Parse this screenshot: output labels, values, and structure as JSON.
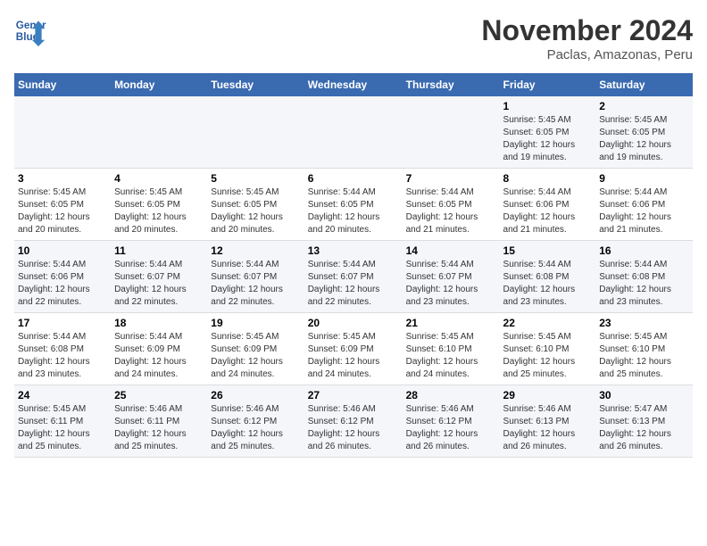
{
  "header": {
    "logo_line1": "General",
    "logo_line2": "Blue",
    "title": "November 2024",
    "subtitle": "Paclas, Amazonas, Peru"
  },
  "weekdays": [
    "Sunday",
    "Monday",
    "Tuesday",
    "Wednesday",
    "Thursday",
    "Friday",
    "Saturday"
  ],
  "weeks": [
    {
      "days": [
        {
          "num": "",
          "info": ""
        },
        {
          "num": "",
          "info": ""
        },
        {
          "num": "",
          "info": ""
        },
        {
          "num": "",
          "info": ""
        },
        {
          "num": "",
          "info": ""
        },
        {
          "num": "1",
          "info": "Sunrise: 5:45 AM\nSunset: 6:05 PM\nDaylight: 12 hours\nand 19 minutes."
        },
        {
          "num": "2",
          "info": "Sunrise: 5:45 AM\nSunset: 6:05 PM\nDaylight: 12 hours\nand 19 minutes."
        }
      ]
    },
    {
      "days": [
        {
          "num": "3",
          "info": "Sunrise: 5:45 AM\nSunset: 6:05 PM\nDaylight: 12 hours\nand 20 minutes."
        },
        {
          "num": "4",
          "info": "Sunrise: 5:45 AM\nSunset: 6:05 PM\nDaylight: 12 hours\nand 20 minutes."
        },
        {
          "num": "5",
          "info": "Sunrise: 5:45 AM\nSunset: 6:05 PM\nDaylight: 12 hours\nand 20 minutes."
        },
        {
          "num": "6",
          "info": "Sunrise: 5:44 AM\nSunset: 6:05 PM\nDaylight: 12 hours\nand 20 minutes."
        },
        {
          "num": "7",
          "info": "Sunrise: 5:44 AM\nSunset: 6:05 PM\nDaylight: 12 hours\nand 21 minutes."
        },
        {
          "num": "8",
          "info": "Sunrise: 5:44 AM\nSunset: 6:06 PM\nDaylight: 12 hours\nand 21 minutes."
        },
        {
          "num": "9",
          "info": "Sunrise: 5:44 AM\nSunset: 6:06 PM\nDaylight: 12 hours\nand 21 minutes."
        }
      ]
    },
    {
      "days": [
        {
          "num": "10",
          "info": "Sunrise: 5:44 AM\nSunset: 6:06 PM\nDaylight: 12 hours\nand 22 minutes."
        },
        {
          "num": "11",
          "info": "Sunrise: 5:44 AM\nSunset: 6:07 PM\nDaylight: 12 hours\nand 22 minutes."
        },
        {
          "num": "12",
          "info": "Sunrise: 5:44 AM\nSunset: 6:07 PM\nDaylight: 12 hours\nand 22 minutes."
        },
        {
          "num": "13",
          "info": "Sunrise: 5:44 AM\nSunset: 6:07 PM\nDaylight: 12 hours\nand 22 minutes."
        },
        {
          "num": "14",
          "info": "Sunrise: 5:44 AM\nSunset: 6:07 PM\nDaylight: 12 hours\nand 23 minutes."
        },
        {
          "num": "15",
          "info": "Sunrise: 5:44 AM\nSunset: 6:08 PM\nDaylight: 12 hours\nand 23 minutes."
        },
        {
          "num": "16",
          "info": "Sunrise: 5:44 AM\nSunset: 6:08 PM\nDaylight: 12 hours\nand 23 minutes."
        }
      ]
    },
    {
      "days": [
        {
          "num": "17",
          "info": "Sunrise: 5:44 AM\nSunset: 6:08 PM\nDaylight: 12 hours\nand 23 minutes."
        },
        {
          "num": "18",
          "info": "Sunrise: 5:44 AM\nSunset: 6:09 PM\nDaylight: 12 hours\nand 24 minutes."
        },
        {
          "num": "19",
          "info": "Sunrise: 5:45 AM\nSunset: 6:09 PM\nDaylight: 12 hours\nand 24 minutes."
        },
        {
          "num": "20",
          "info": "Sunrise: 5:45 AM\nSunset: 6:09 PM\nDaylight: 12 hours\nand 24 minutes."
        },
        {
          "num": "21",
          "info": "Sunrise: 5:45 AM\nSunset: 6:10 PM\nDaylight: 12 hours\nand 24 minutes."
        },
        {
          "num": "22",
          "info": "Sunrise: 5:45 AM\nSunset: 6:10 PM\nDaylight: 12 hours\nand 25 minutes."
        },
        {
          "num": "23",
          "info": "Sunrise: 5:45 AM\nSunset: 6:10 PM\nDaylight: 12 hours\nand 25 minutes."
        }
      ]
    },
    {
      "days": [
        {
          "num": "24",
          "info": "Sunrise: 5:45 AM\nSunset: 6:11 PM\nDaylight: 12 hours\nand 25 minutes."
        },
        {
          "num": "25",
          "info": "Sunrise: 5:46 AM\nSunset: 6:11 PM\nDaylight: 12 hours\nand 25 minutes."
        },
        {
          "num": "26",
          "info": "Sunrise: 5:46 AM\nSunset: 6:12 PM\nDaylight: 12 hours\nand 25 minutes."
        },
        {
          "num": "27",
          "info": "Sunrise: 5:46 AM\nSunset: 6:12 PM\nDaylight: 12 hours\nand 26 minutes."
        },
        {
          "num": "28",
          "info": "Sunrise: 5:46 AM\nSunset: 6:12 PM\nDaylight: 12 hours\nand 26 minutes."
        },
        {
          "num": "29",
          "info": "Sunrise: 5:46 AM\nSunset: 6:13 PM\nDaylight: 12 hours\nand 26 minutes."
        },
        {
          "num": "30",
          "info": "Sunrise: 5:47 AM\nSunset: 6:13 PM\nDaylight: 12 hours\nand 26 minutes."
        }
      ]
    }
  ]
}
